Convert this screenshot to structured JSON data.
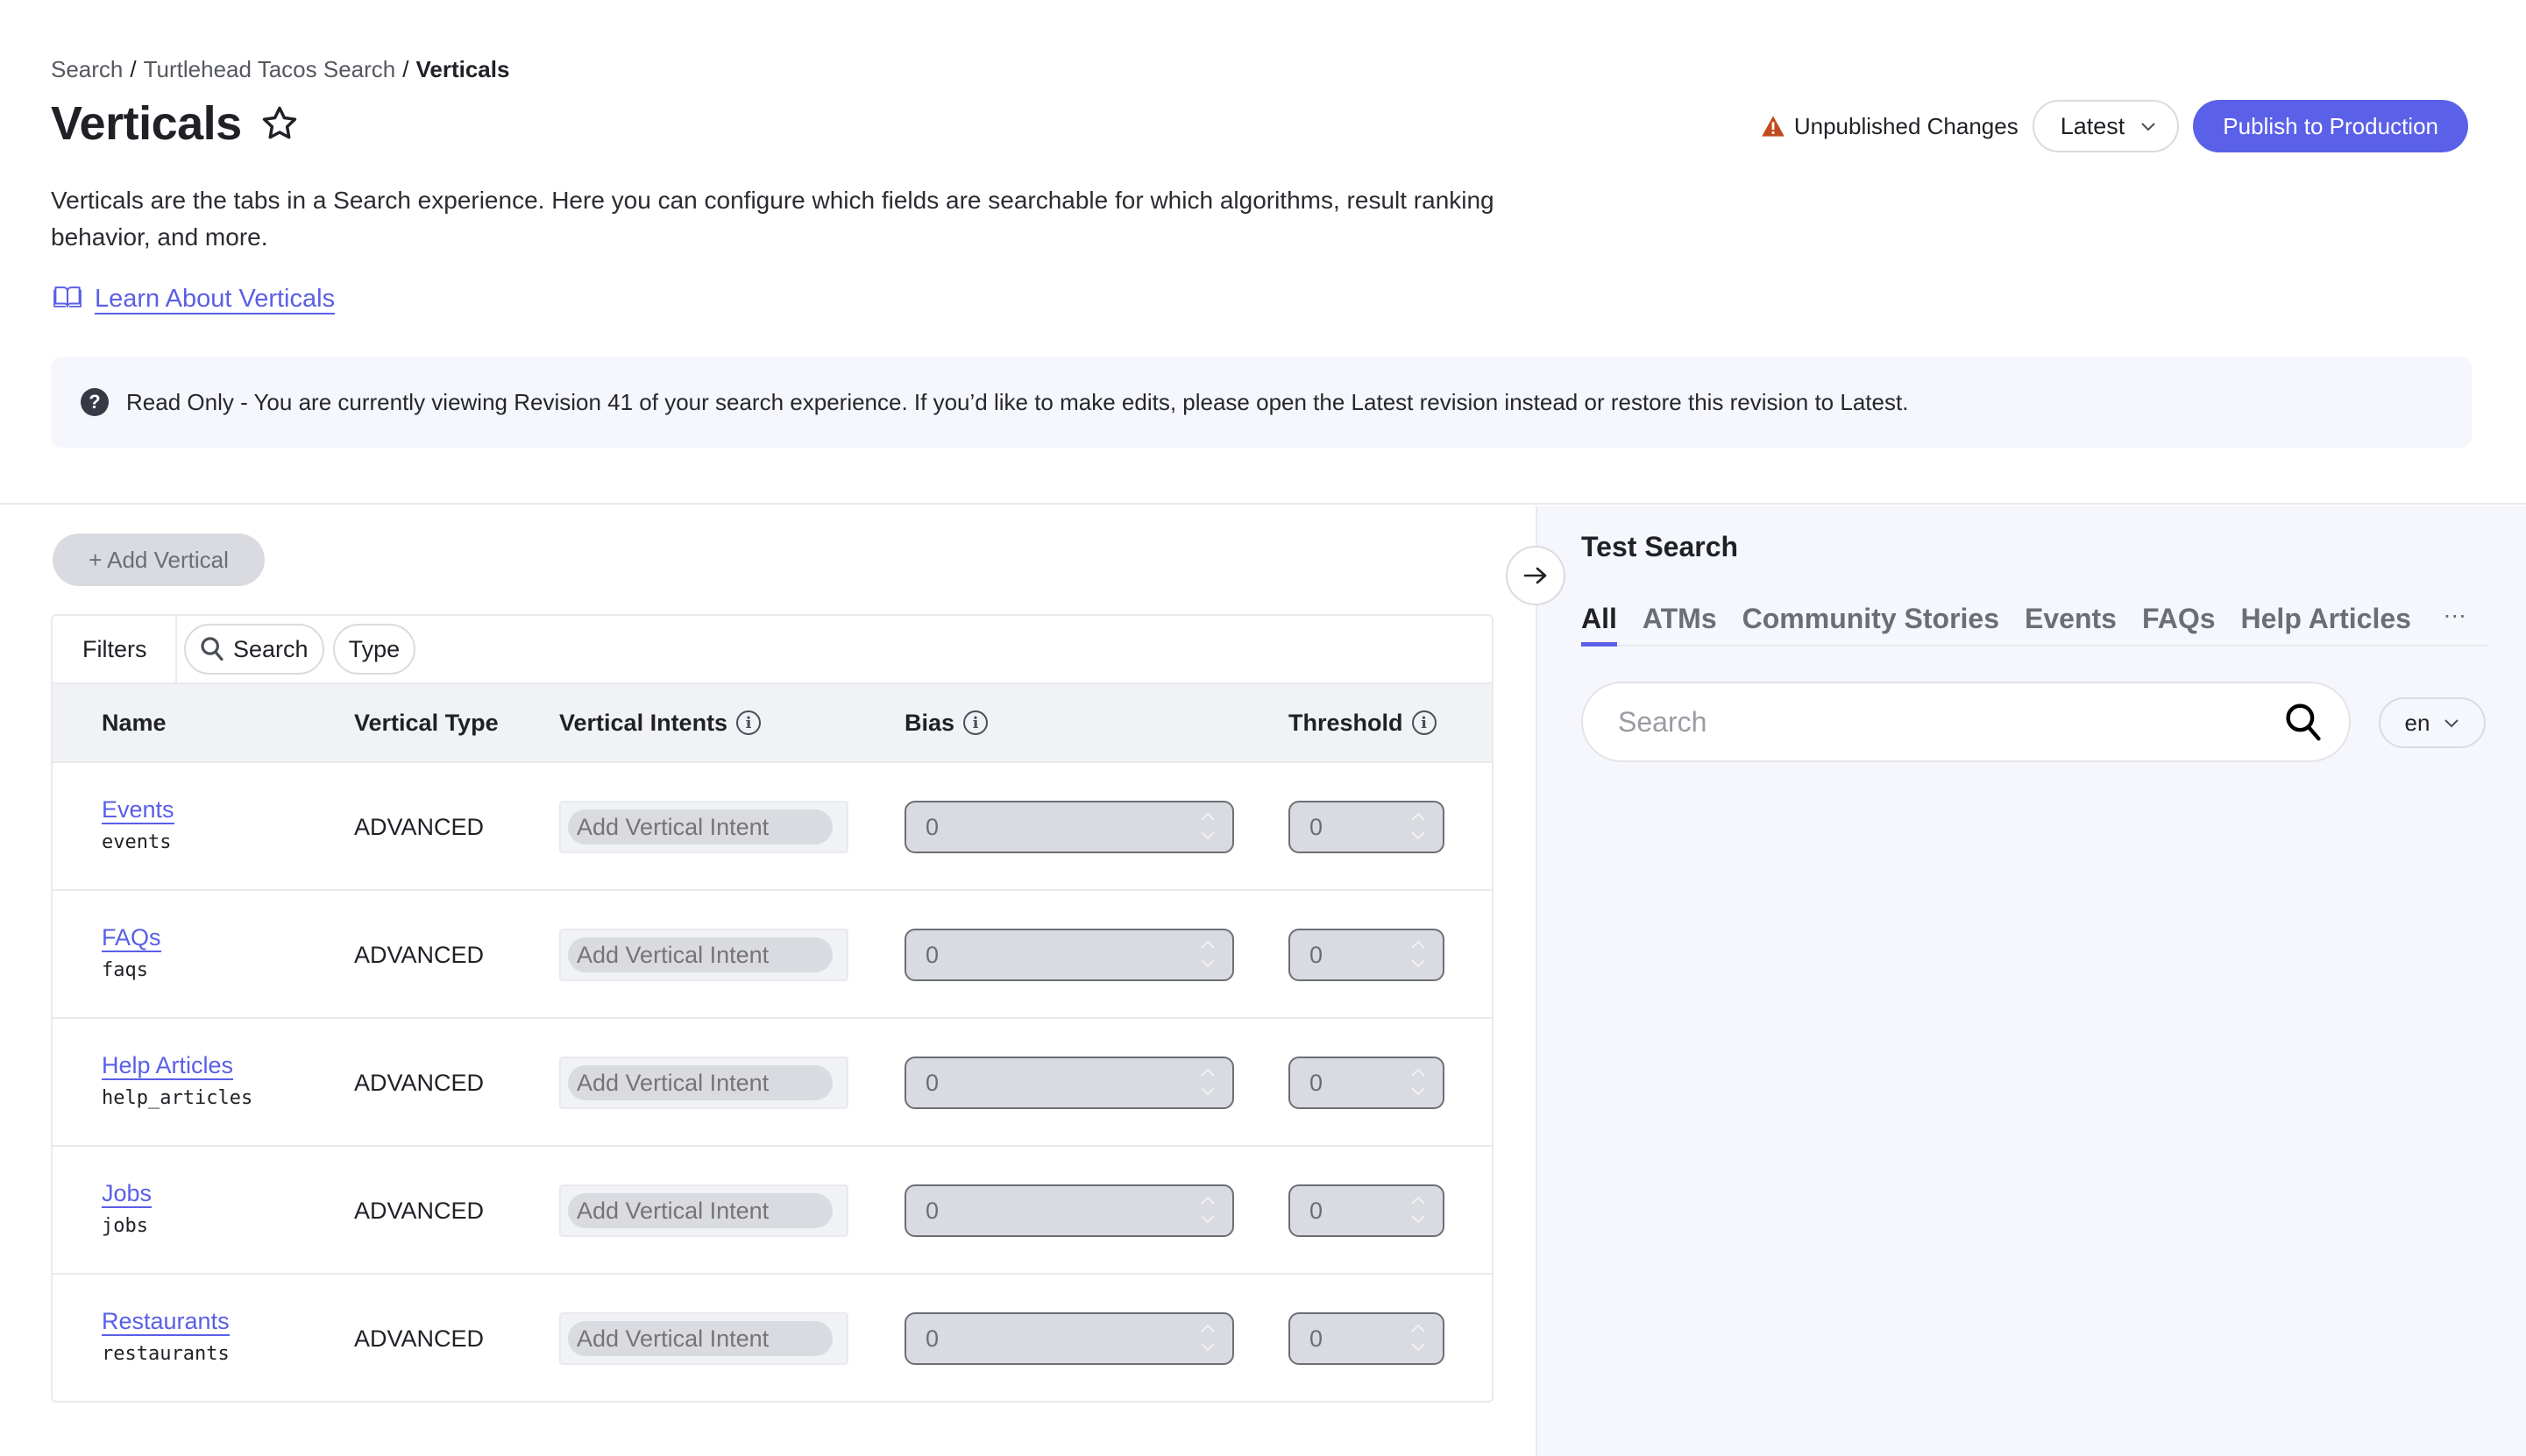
{
  "breadcrumb": {
    "items": [
      "Search",
      "Turtlehead Tacos Search"
    ],
    "current": "Verticals",
    "separator": "/"
  },
  "page": {
    "title": "Verticals",
    "description": "Verticals are the tabs in a Search experience. Here you can configure which fields are searchable for which algorithms, result ranking behavior, and more.",
    "learn_link": "Learn About Verticals"
  },
  "header": {
    "unpublished_label": "Unpublished Changes",
    "version_select": "Latest",
    "publish_label": "Publish to Production"
  },
  "banner": {
    "text": "Read Only - You are currently viewing Revision 41 of your search experience. If you’d like to make edits, please open the Latest revision instead or restore this revision to Latest."
  },
  "toolbar": {
    "add_vertical_label": "+ Add Vertical"
  },
  "filters": {
    "label": "Filters",
    "chips": [
      "Search",
      "Type"
    ]
  },
  "table": {
    "columns": [
      "Name",
      "Vertical Type",
      "Vertical Intents",
      "Bias",
      "Threshold"
    ],
    "intent_placeholder": "Add Vertical Intent",
    "rows": [
      {
        "name": "Events",
        "api_name": "events",
        "type": "ADVANCED",
        "bias": "0",
        "threshold": "0"
      },
      {
        "name": "FAQs",
        "api_name": "faqs",
        "type": "ADVANCED",
        "bias": "0",
        "threshold": "0"
      },
      {
        "name": "Help Articles",
        "api_name": "help_articles",
        "type": "ADVANCED",
        "bias": "0",
        "threshold": "0"
      },
      {
        "name": "Jobs",
        "api_name": "jobs",
        "type": "ADVANCED",
        "bias": "0",
        "threshold": "0"
      },
      {
        "name": "Restaurants",
        "api_name": "restaurants",
        "type": "ADVANCED",
        "bias": "0",
        "threshold": "0"
      }
    ]
  },
  "test_search": {
    "title": "Test Search",
    "tabs": [
      "All",
      "ATMs",
      "Community Stories",
      "Events",
      "FAQs",
      "Help Articles"
    ],
    "active_tab": "All",
    "more_label": "...",
    "search_placeholder": "Search",
    "language": "en"
  },
  "colors": {
    "accent": "#5b60e8",
    "warning": "#c24a1f",
    "panel_bg": "#f6f7fc"
  }
}
